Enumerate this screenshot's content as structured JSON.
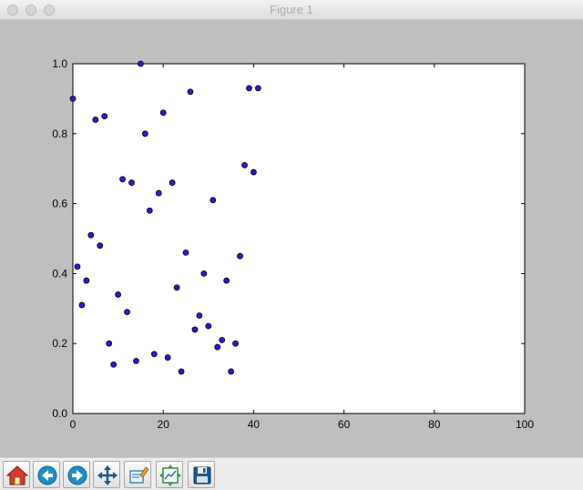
{
  "window": {
    "title": "Figure 1"
  },
  "toolbar": {
    "buttons": [
      {
        "name": "home-button",
        "icon": "home-icon"
      },
      {
        "name": "back-button",
        "icon": "back-arrow-icon"
      },
      {
        "name": "forward-button",
        "icon": "forward-arrow-icon"
      },
      {
        "name": "pan-button",
        "icon": "move-icon"
      },
      {
        "name": "zoom-button",
        "icon": "zoom-rect-icon"
      },
      {
        "name": "subplots-button",
        "icon": "configure-subplots-icon"
      },
      {
        "name": "save-button",
        "icon": "save-disk-icon"
      }
    ]
  },
  "chart_data": {
    "type": "scatter",
    "title": "",
    "xlabel": "",
    "ylabel": "",
    "xlim": [
      0,
      100
    ],
    "ylim": [
      0.0,
      1.0
    ],
    "xticks": [
      "0",
      "20",
      "40",
      "60",
      "80",
      "100"
    ],
    "yticks": [
      "0.0",
      "0.2",
      "0.4",
      "0.6",
      "0.8",
      "1.0"
    ],
    "grid": false,
    "marker_color": "#2a1bd6",
    "points": [
      [
        0,
        0.9
      ],
      [
        1,
        0.42
      ],
      [
        2,
        0.31
      ],
      [
        3,
        0.38
      ],
      [
        4,
        0.51
      ],
      [
        5,
        0.84
      ],
      [
        6,
        0.48
      ],
      [
        7,
        0.85
      ],
      [
        8,
        0.2
      ],
      [
        9,
        0.14
      ],
      [
        10,
        0.34
      ],
      [
        11,
        0.67
      ],
      [
        12,
        0.29
      ],
      [
        13,
        0.66
      ],
      [
        14,
        0.15
      ],
      [
        15,
        1.0
      ],
      [
        16,
        0.8
      ],
      [
        17,
        0.58
      ],
      [
        18,
        0.17
      ],
      [
        19,
        0.63
      ],
      [
        20,
        0.86
      ],
      [
        21,
        0.16
      ],
      [
        22,
        0.66
      ],
      [
        23,
        0.36
      ],
      [
        24,
        0.12
      ],
      [
        25,
        0.46
      ],
      [
        26,
        0.92
      ],
      [
        27,
        0.24
      ],
      [
        28,
        0.28
      ],
      [
        29,
        0.4
      ],
      [
        30,
        0.25
      ],
      [
        31,
        0.61
      ],
      [
        32,
        0.19
      ],
      [
        33,
        0.21
      ],
      [
        34,
        0.38
      ],
      [
        35,
        0.12
      ],
      [
        36,
        0.2
      ],
      [
        37,
        0.45
      ],
      [
        38,
        0.71
      ],
      [
        39,
        0.93
      ],
      [
        40,
        0.69
      ],
      [
        41,
        0.93
      ]
    ]
  }
}
